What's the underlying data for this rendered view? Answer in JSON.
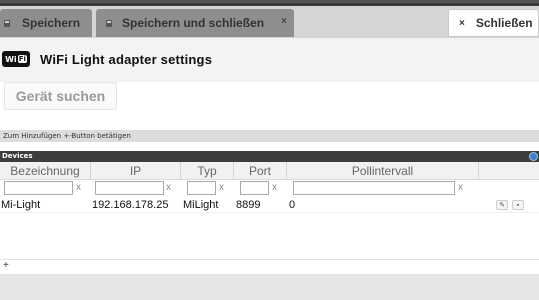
{
  "tabs": [
    {
      "label": "Speichern"
    },
    {
      "label": "Speichern und schließen",
      "close": "×"
    },
    {
      "label": "Schließen",
      "close": "×"
    }
  ],
  "header": {
    "logo_text": "Wi",
    "logo_badge": "Fi",
    "title": "WiFi Light adapter settings"
  },
  "search_button": {
    "label": "Gerät suchen"
  },
  "hint": "Zum Hinzufügen +-Button betätigen",
  "devices": {
    "title": "Devices",
    "columns": [
      "Bezeichnung",
      "IP",
      "Typ",
      "Port",
      "Pollintervall"
    ],
    "filter_clear": "x",
    "rows": [
      {
        "name": "Mi-Light",
        "ip": "192.168.178.25",
        "type": "MiLight",
        "port": "8899",
        "poll": "0"
      }
    ],
    "add": "+"
  }
}
